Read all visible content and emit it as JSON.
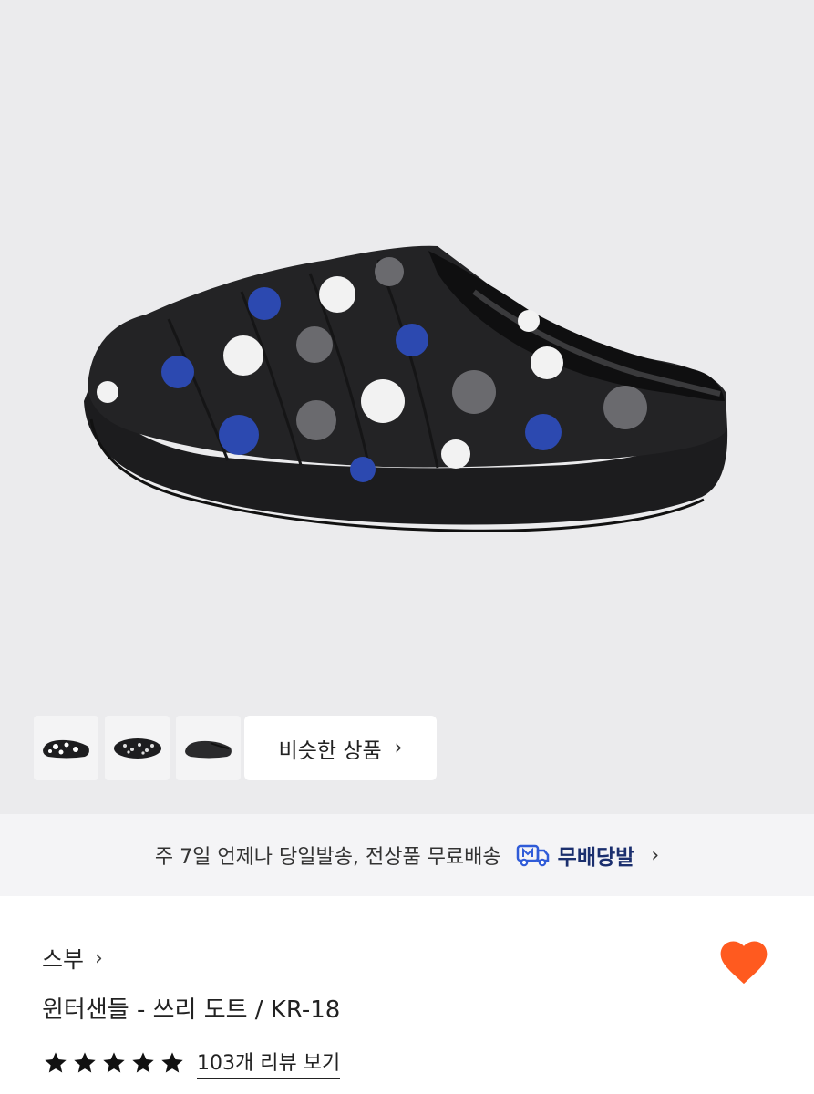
{
  "product_image": {
    "alt_icon": "slipper-image"
  },
  "thumbnails": [
    {
      "icon": "thumb-slipper-side"
    },
    {
      "icon": "thumb-slipper-top"
    },
    {
      "icon": "thumb-slipper-black"
    }
  ],
  "similar": {
    "label": "비슷한 상품",
    "chevron": "›"
  },
  "shipping": {
    "text": "주 7일 언제나 당일발송, 전상품 무료배송",
    "badge_label": "무배당발",
    "chevron": "›"
  },
  "product": {
    "brand": "스부",
    "brand_chevron": "›",
    "title": "윈터샌들 - 쓰리 도트 / KR-18",
    "rating_stars": 5,
    "review_link": "103개 리뷰 보기"
  },
  "colors": {
    "accent_heart": "#ff5a1f",
    "badge_blue": "#2f5bd8",
    "badge_text": "#1b2f6e"
  }
}
